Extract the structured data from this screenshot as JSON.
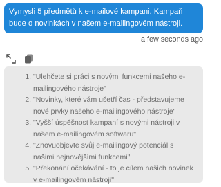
{
  "user_message": "Vymysli 5 předmětů k e-mailové kampani. Kampaň bude o novinkách v našem e-mailingovém nástroji.",
  "timestamp": "a few seconds ago",
  "toolbar": {
    "expand_icon": "expand-icon",
    "copy_icon": "copy-icon"
  },
  "response": {
    "items": [
      "\"Ulehčete si práci s novými funkcemi našeho e-mailingového nástroje\"",
      "\"Novinky, které vám ušetří čas - představujeme nové prvky našeho e-mailingového nástroje\"",
      "\"Vyšší úspěšnost kampaní s novými nástroji v našem e-mailingovém softwaru\"",
      "\"Znovuobjevte svůj e-mailingový potenciál s našimi nejnovějšími funkcemi\"",
      "\"Překonání očekávání - to je cílem našich novinek v e-mailingovém nástroji\""
    ]
  },
  "colors": {
    "user_bubble": "#1f86d8",
    "assistant_bubble": "#e9e9e9",
    "assistant_text": "#6d6d6d"
  }
}
